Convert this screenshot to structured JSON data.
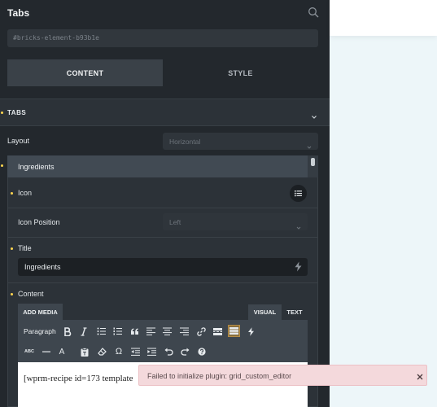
{
  "panel": {
    "title": "Tabs",
    "element_id": "#bricks-element-b93b1e",
    "tabs": [
      {
        "label": "CONTENT"
      },
      {
        "label": "STYLE"
      }
    ]
  },
  "section": {
    "label": "TABS"
  },
  "layout": {
    "label": "Layout",
    "value": "Horizontal"
  },
  "item": {
    "label": "Ingredients",
    "icon_label": "Icon",
    "icon_position_label": "Icon Position",
    "icon_position_value": "Left",
    "title_label": "Title",
    "title_value": "Ingredients",
    "content_label": "Content"
  },
  "editor": {
    "add_media": "ADD MEDIA",
    "visual_tab": "VISUAL",
    "text_tab": "TEXT",
    "format_select": "Paragraph",
    "omega_symbol": "Ω",
    "font_color_symbol": "A",
    "abc_symbol": "ABC",
    "content": "[wprm-recipe id=173 template"
  },
  "toast": {
    "message": "Failed to initialize plugin: grid_custom_editor"
  },
  "colors": {
    "accent_dot": "#ffd64f",
    "panel_bg": "#23282d",
    "toast_bg": "#f4d9dc"
  }
}
